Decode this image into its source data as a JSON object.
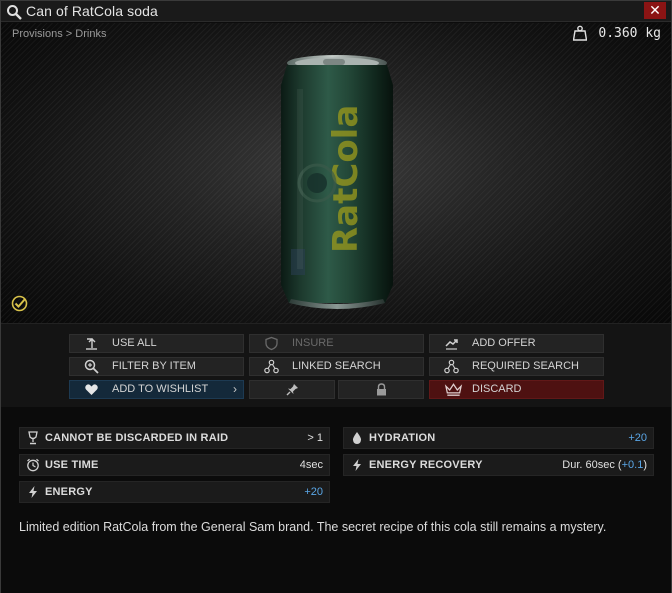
{
  "window": {
    "title": "Can of RatCola soda",
    "breadcrumb": "Provisions > Drinks",
    "weight": "0.360 kg",
    "close_label": "✕"
  },
  "actions": {
    "use_all": "USE ALL",
    "insure": "INSURE",
    "add_offer": "ADD OFFER",
    "filter_by_item": "FILTER BY ITEM",
    "linked_search": "LINKED SEARCH",
    "required_search": "REQUIRED SEARCH",
    "add_to_wishlist": "ADD TO WISHLIST",
    "discard": "DISCARD"
  },
  "stats": {
    "cannot_discard": {
      "label": "CANNOT BE DISCARDED IN RAID",
      "value": "> 1"
    },
    "hydration": {
      "label": "HYDRATION",
      "value": "+20"
    },
    "use_time": {
      "label": "USE TIME",
      "value": "4sec"
    },
    "energy_recovery": {
      "label": "ENERGY RECOVERY",
      "value_prefix": "Dur. 60sec (",
      "value_accent": "+0.1",
      "value_suffix": ")"
    },
    "energy": {
      "label": "ENERGY",
      "value": "+20"
    }
  },
  "description": "Limited edition RatCola from the General Sam brand. The secret recipe of this cola still remains a mystery.",
  "colors": {
    "accent_blue": "#5aa6e6",
    "discard_red": "#4e1111",
    "wishlist_blue": "#14293a",
    "close_red": "#8b1414",
    "check_yellow": "#d8c24a"
  },
  "icons": {
    "title": "search-icon",
    "weight": "weight-icon",
    "found_in_raid": "checkmark-icon",
    "use_all": "use-icon",
    "insure": "shield-icon",
    "add_offer": "handshake-icon",
    "filter_by_item": "magnifier-plus-icon",
    "linked_search": "nodes-icon",
    "required_search": "nodes-icon",
    "add_to_wishlist": "heart-icon",
    "pin": "pin-icon",
    "lock": "lock-icon",
    "discard": "crown-icon",
    "cannot_discard": "trophy-icon",
    "hydration": "drop-icon",
    "use_time": "clock-icon",
    "energy_recovery": "bolt-icon",
    "energy": "bolt-icon"
  }
}
